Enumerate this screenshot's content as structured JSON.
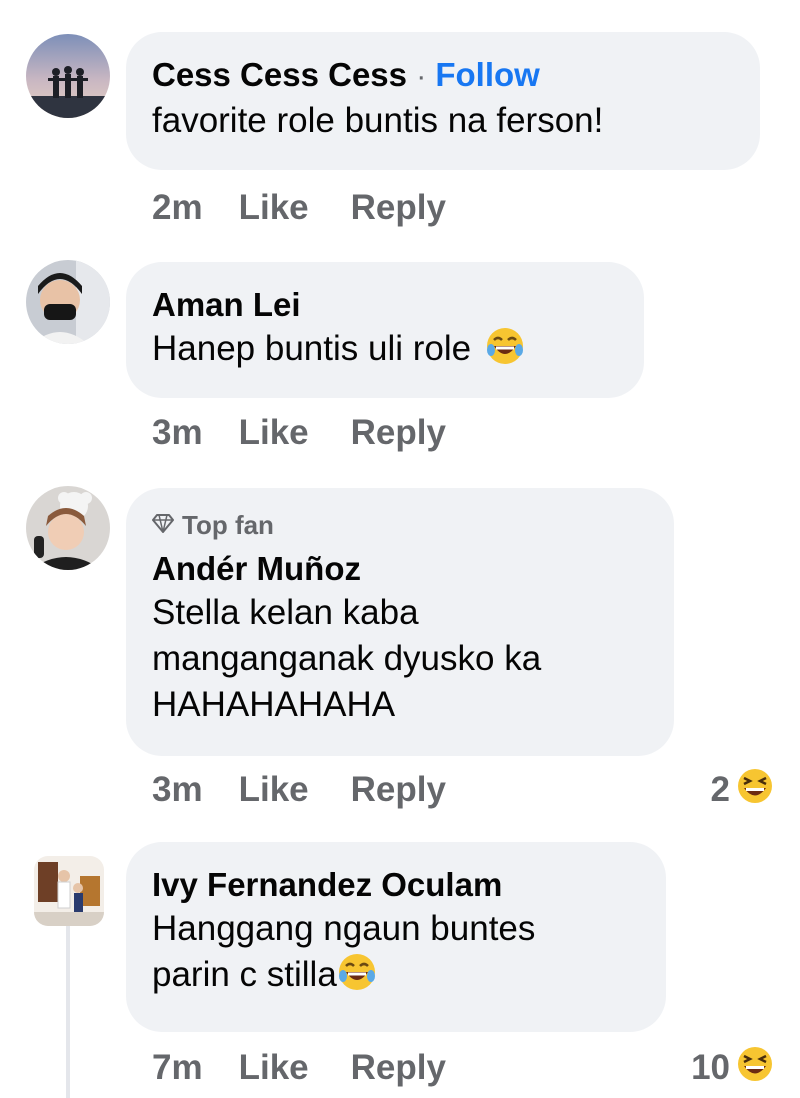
{
  "comments": [
    {
      "name": "Cess Cess Cess",
      "separator": "·",
      "follow_label": "Follow",
      "text": "favorite role buntis na ferson!",
      "time": "2m",
      "like_label": "Like",
      "reply_label": "Reply"
    },
    {
      "name": "Aman Lei",
      "text": "Hanep buntis uli role",
      "time": "3m",
      "like_label": "Like",
      "reply_label": "Reply"
    },
    {
      "badge": "Top fan",
      "name": "Andér Muñoz",
      "text_lines": [
        "Stella kelan kaba",
        "manganganak dyusko ka",
        "HAHAHAHAHA"
      ],
      "time": "3m",
      "like_label": "Like",
      "reply_label": "Reply",
      "reaction_count": "2"
    },
    {
      "name": "Ivy Fernandez Oculam",
      "text_lines": [
        "Hanggang ngaun buntes",
        "parin c stilla"
      ],
      "time": "7m",
      "like_label": "Like",
      "reply_label": "Reply",
      "reaction_count": "10"
    }
  ],
  "colors": {
    "bubble": "#f0f2f5",
    "secondary_text": "#65676b",
    "follow": "#1877f2",
    "emoji_yellow": "#f7c531"
  },
  "icons": [
    "diamond-icon",
    "laughing-emoji-icon",
    "squinting-laugh-emoji-icon"
  ]
}
